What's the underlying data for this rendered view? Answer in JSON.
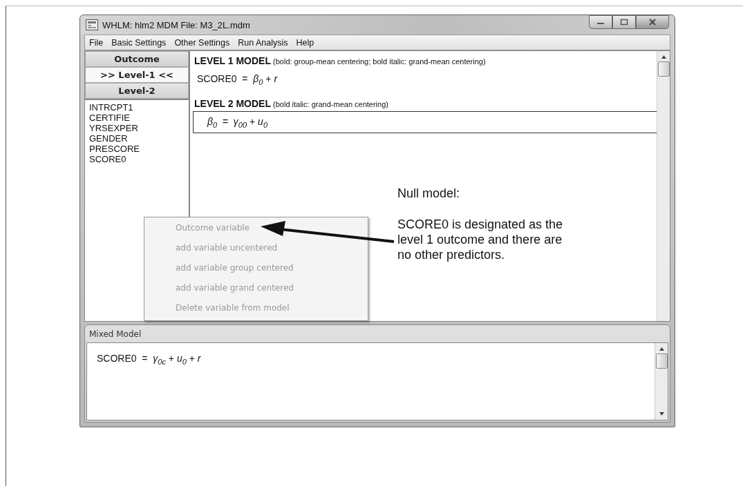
{
  "window": {
    "title": "WHLM: hlm2 MDM File: M3_2L.mdm"
  },
  "menu": [
    "File",
    "Basic Settings",
    "Other Settings",
    "Run Analysis",
    "Help"
  ],
  "sidebar": {
    "buttons": [
      {
        "label": "Outcome",
        "selected": false
      },
      {
        "label": ">> Level-1 <<",
        "selected": true
      },
      {
        "label": "Level-2",
        "selected": false
      }
    ],
    "variables": [
      "INTRCPT1",
      "CERTIFIE",
      "YRSEXPER",
      "GENDER",
      "PRESCORE",
      "SCORE0"
    ]
  },
  "level1": {
    "heading": "LEVEL 1 MODEL",
    "note": "(bold: group-mean centering; bold italic: grand-mean centering)",
    "equation": "SCORE0  =  *β*$_{0}$ + *r*"
  },
  "level2": {
    "heading": "LEVEL 2 MODEL",
    "note": "(bold italic: grand-mean centering)",
    "equation": "*β*$_{0}$  =  *γ*$_{00}$ + *u*$_{0}$"
  },
  "context_menu": [
    {
      "label": "Outcome variable",
      "disabled": true
    },
    {
      "label": "add variable uncentered",
      "disabled": true
    },
    {
      "label": "add variable group centered",
      "disabled": true
    },
    {
      "label": "add variable grand centered",
      "disabled": true
    },
    {
      "label": "Delete variable from model",
      "disabled": true
    }
  ],
  "annotation": {
    "title": "Null model:",
    "text": "SCORE0 is designated as the level 1 outcome and there are no other predictors."
  },
  "mixed_model": {
    "title": "Mixed Model",
    "equation": "SCORE0  =  *γ*$_{0c}$ + *u*$_{0}$ + *r*"
  }
}
